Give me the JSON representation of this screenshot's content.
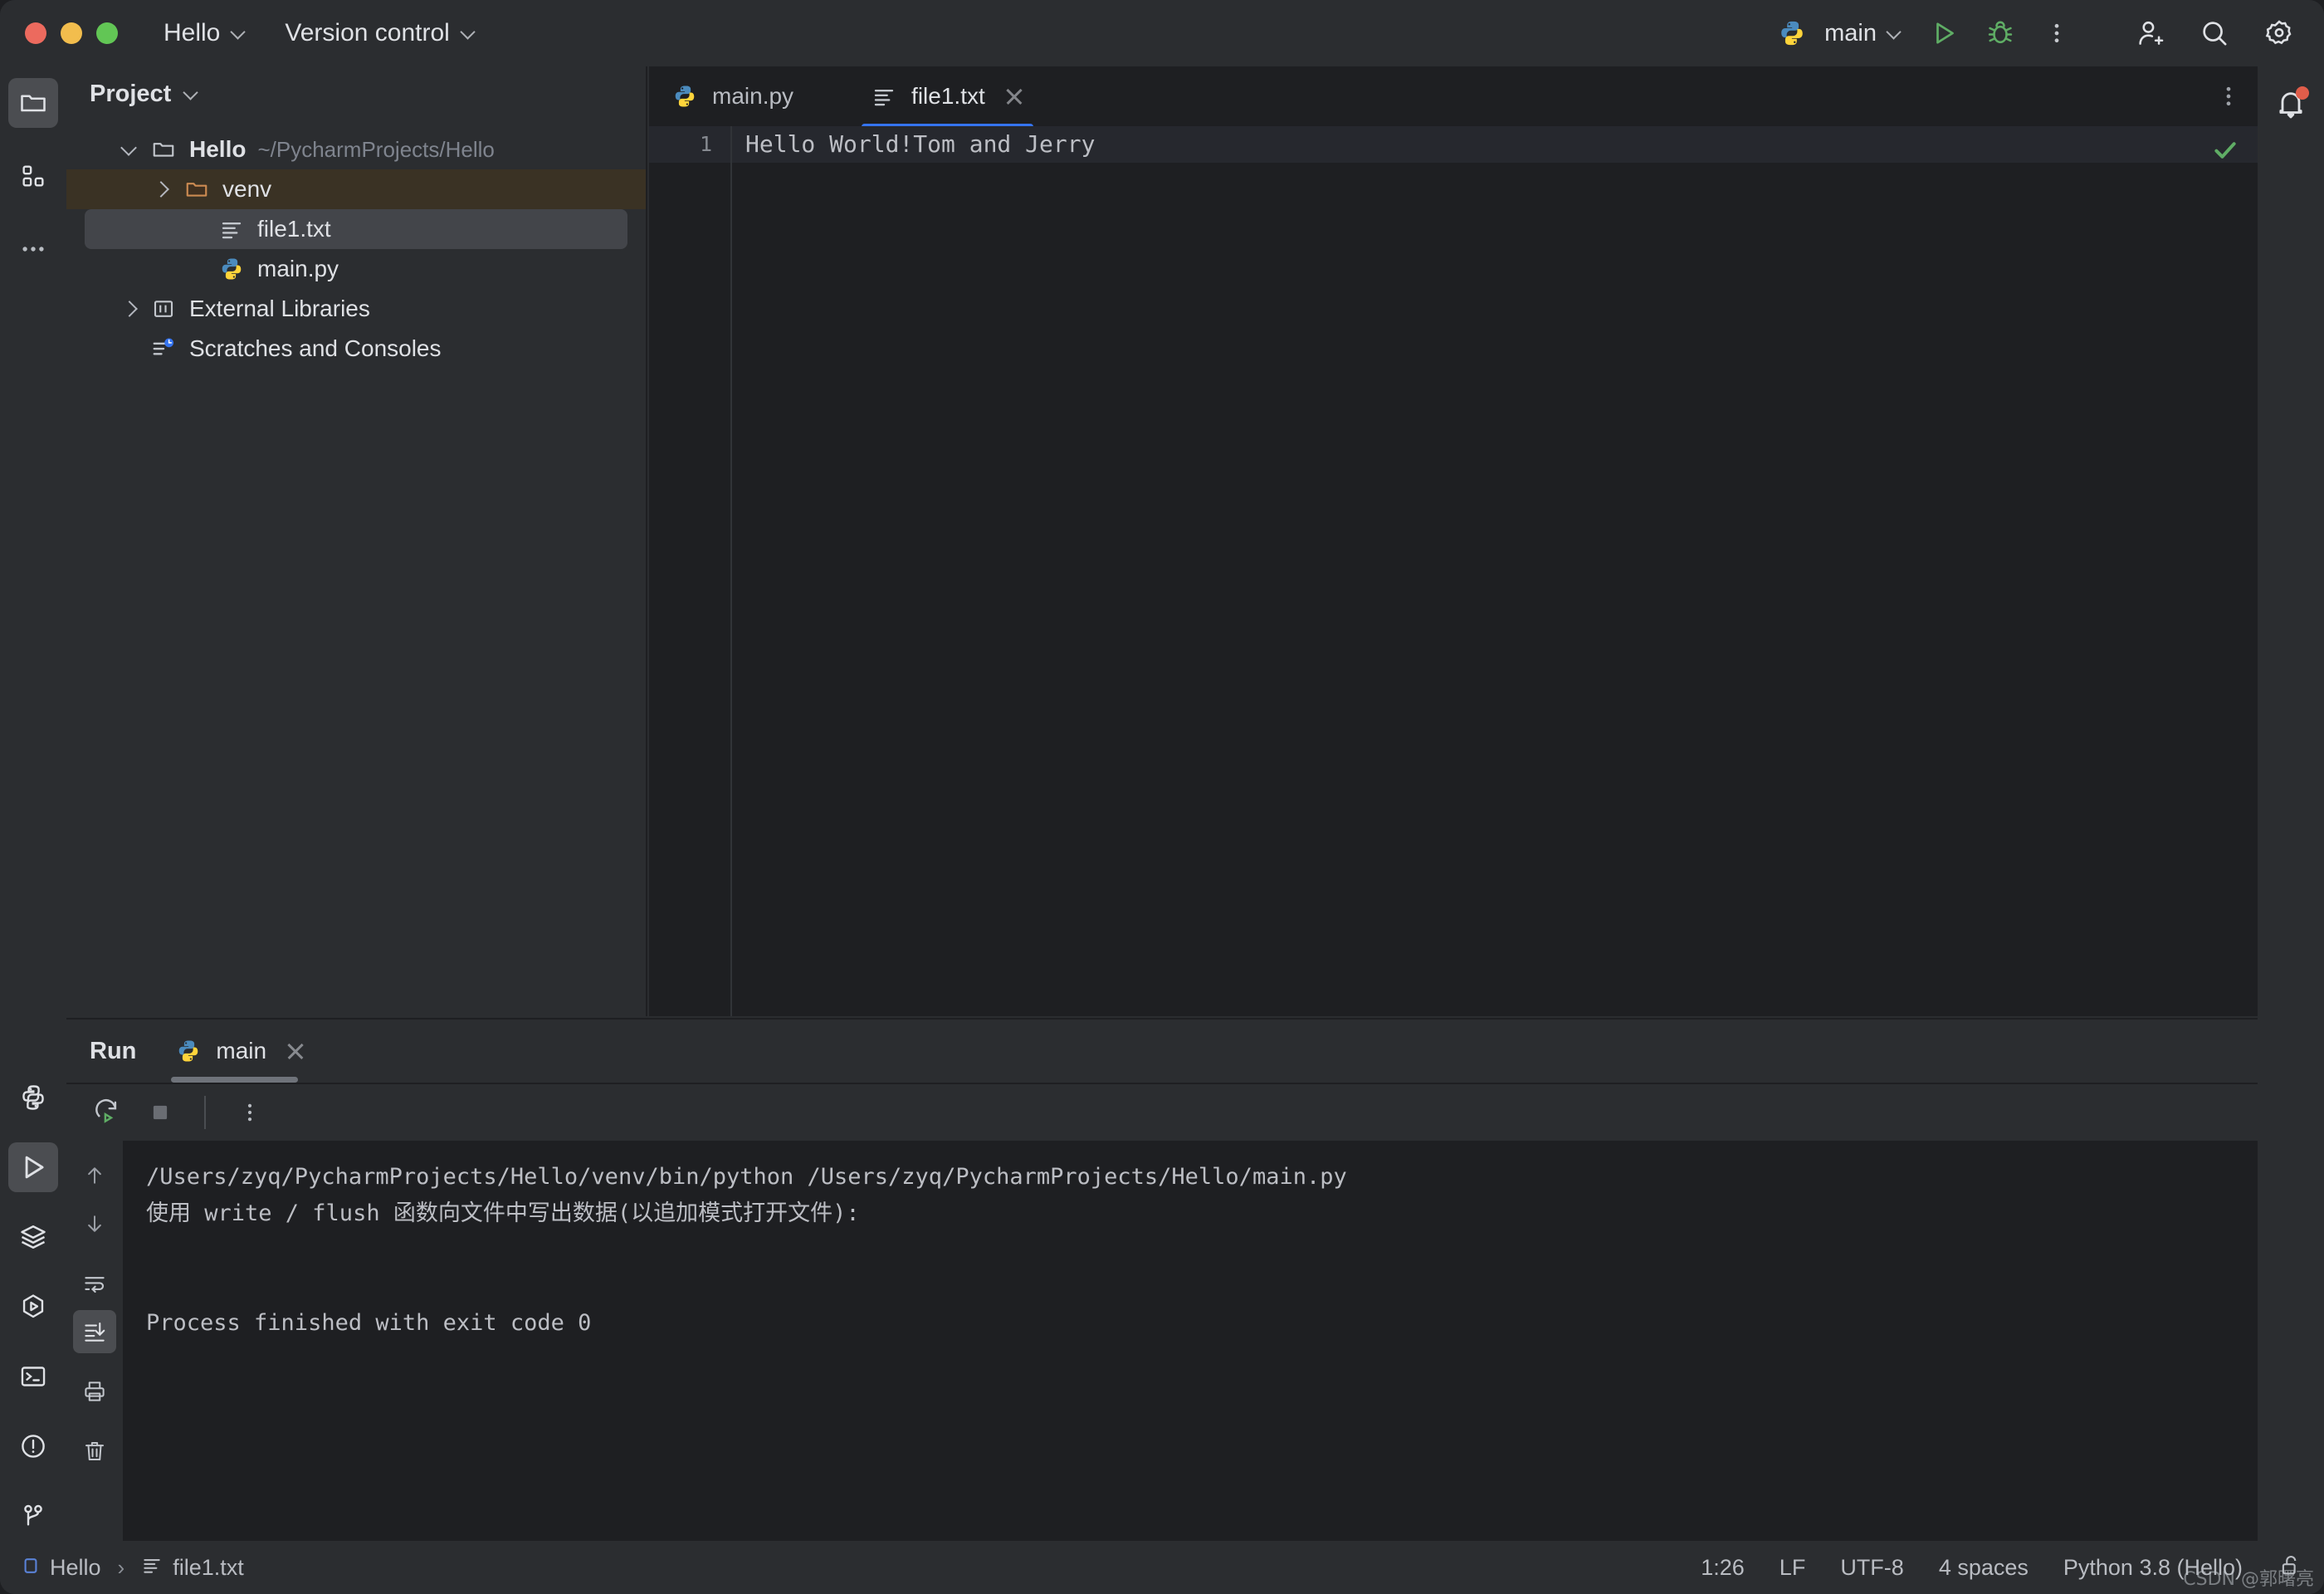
{
  "window": {
    "title": "Hello",
    "traffic_lights": [
      "close",
      "minimize",
      "maximize"
    ]
  },
  "titlebar": {
    "project_menu": "Hello",
    "vcs_menu": "Version control",
    "run_config": "main",
    "icons": {
      "python": "python-icon",
      "run": "run-icon",
      "debug": "debug-icon",
      "more": "more-vertical-icon",
      "add_user": "add-user-icon",
      "search": "search-icon",
      "settings": "gear-icon"
    }
  },
  "activity_bar": {
    "top_items": [
      {
        "name": "project-tool-window",
        "icon": "folder-icon",
        "selected": true
      },
      {
        "name": "structure-tool-window",
        "icon": "grid-icon",
        "selected": false
      },
      {
        "name": "more-tool-windows",
        "icon": "ellipsis-icon",
        "selected": false
      }
    ],
    "bottom_items": [
      {
        "name": "python-packages",
        "icon": "python-outline-icon",
        "selected": false
      },
      {
        "name": "run-tool-window",
        "icon": "play-icon",
        "selected": true
      },
      {
        "name": "services-tool-window",
        "icon": "layers-icon",
        "selected": false
      },
      {
        "name": "python-console",
        "icon": "hexagon-play-icon",
        "selected": false
      },
      {
        "name": "terminal-tool-window",
        "icon": "terminal-icon",
        "selected": false
      },
      {
        "name": "problems-tool-window",
        "icon": "exclamation-circle-icon",
        "selected": false
      },
      {
        "name": "version-control-tool-window",
        "icon": "branch-icon",
        "selected": false
      }
    ]
  },
  "project_panel": {
    "title": "Project",
    "tree": [
      {
        "level": 0,
        "arrow": "down",
        "icon": "folder-icon",
        "label": "Hello",
        "bold": true,
        "sub": "~/PycharmProjects/Hello",
        "state": "none"
      },
      {
        "level": 1,
        "arrow": "right",
        "icon": "folder-orange-icon",
        "label": "venv",
        "bold": false,
        "sub": "",
        "state": "venv-highlight"
      },
      {
        "level": 1,
        "arrow": "none",
        "icon": "text-file-icon",
        "label": "file1.txt",
        "bold": false,
        "sub": "",
        "state": "selected"
      },
      {
        "level": 1,
        "arrow": "none",
        "icon": "python-icon",
        "label": "main.py",
        "bold": false,
        "sub": "",
        "state": "none"
      },
      {
        "level": 0,
        "arrow": "right",
        "icon": "library-icon",
        "label": "External Libraries",
        "bold": false,
        "sub": "",
        "state": "none"
      },
      {
        "level": 0,
        "arrow": "none",
        "icon": "scratches-icon",
        "label": "Scratches and Consoles",
        "bold": false,
        "sub": "",
        "state": "none"
      }
    ]
  },
  "editor": {
    "tabs": [
      {
        "label": "main.py",
        "icon": "python-icon",
        "active": false,
        "closable": false
      },
      {
        "label": "file1.txt",
        "icon": "text-file-icon",
        "active": true,
        "closable": true
      }
    ],
    "accent_color": "#3574f0",
    "lines": [
      {
        "number": "1",
        "text": "Hello World!Tom and Jerry",
        "current": true
      }
    ],
    "inspection_status": "ok-check-icon",
    "more_options_icon": "more-vertical-icon"
  },
  "run_panel": {
    "title": "Run",
    "tab": {
      "label": "main",
      "icon": "python-icon",
      "closable": true
    },
    "toolbar": [
      {
        "name": "rerun-button",
        "icon": "rerun-icon"
      },
      {
        "name": "stop-button",
        "icon": "stop-icon"
      },
      {
        "name": "more-options-button",
        "icon": "more-vertical-icon"
      }
    ],
    "side_toolbar": [
      {
        "name": "up-button",
        "icon": "arrow-up-icon",
        "selected": false
      },
      {
        "name": "down-button",
        "icon": "arrow-down-icon",
        "selected": false
      },
      {
        "name": "soft-wrap-button",
        "icon": "soft-wrap-icon",
        "selected": false
      },
      {
        "name": "scroll-to-end-button",
        "icon": "scroll-to-end-icon",
        "selected": true
      },
      {
        "name": "print-button",
        "icon": "printer-icon",
        "selected": false
      },
      {
        "name": "clear-all-button",
        "icon": "trash-icon",
        "selected": false
      }
    ],
    "console_lines": [
      "/Users/zyq/PycharmProjects/Hello/venv/bin/python /Users/zyq/PycharmProjects/Hello/main.py",
      "使用 write / flush 函数向文件中写出数据(以追加模式打开文件):",
      "",
      "",
      "Process finished with exit code 0"
    ]
  },
  "right_bar": {
    "items": [
      {
        "name": "notifications-button",
        "icon": "bell-icon",
        "badge": true,
        "badge_color": "#e05d4a"
      }
    ]
  },
  "status_bar": {
    "breadcrumb": [
      {
        "label": "Hello",
        "icon": "module-icon"
      },
      {
        "label": "file1.txt",
        "icon": "text-file-icon"
      }
    ],
    "separator": "›",
    "right_items": [
      {
        "name": "caret-position",
        "label": "1:26"
      },
      {
        "name": "line-separator",
        "label": "LF"
      },
      {
        "name": "file-encoding",
        "label": "UTF-8"
      },
      {
        "name": "indent-size",
        "label": "4 spaces"
      },
      {
        "name": "python-interpreter",
        "label": "Python 3.8 (Hello)"
      }
    ],
    "lock_icon": "unlocked-padlock-icon"
  },
  "watermark": {
    "text": "CSDN @郭曙亮"
  }
}
